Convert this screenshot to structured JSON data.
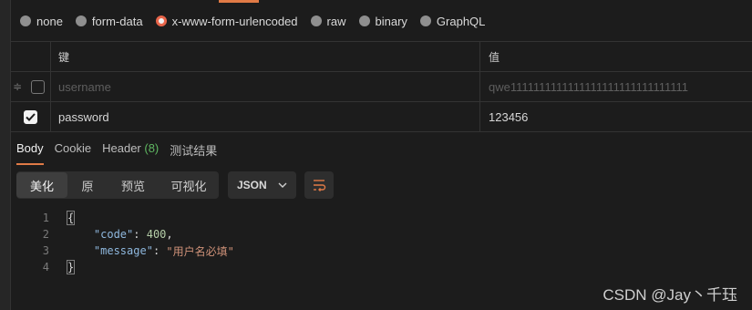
{
  "body_types": [
    {
      "label": "none",
      "selected": false
    },
    {
      "label": "form-data",
      "selected": false
    },
    {
      "label": "x-www-form-urlencoded",
      "selected": true
    },
    {
      "label": "raw",
      "selected": false
    },
    {
      "label": "binary",
      "selected": false
    },
    {
      "label": "GraphQL",
      "selected": false
    }
  ],
  "params_table": {
    "headers": {
      "key": "键",
      "value": "值"
    },
    "placeholder_row": {
      "key": "username",
      "value": "qwe1111111111111111111111111111111",
      "checked": false
    },
    "rows": [
      {
        "key": "password",
        "value": "123456",
        "checked": true
      }
    ]
  },
  "response": {
    "tabs": {
      "body": "Body",
      "cookie": "Cookie",
      "header": "Header",
      "header_count": "(8)",
      "tests": "测试结果"
    },
    "active_tab": "Body",
    "view_modes": [
      "美化",
      "原",
      "预览",
      "可视化"
    ],
    "active_view": "美化",
    "format": "JSON",
    "code": {
      "line_numbers": [
        "1",
        "2",
        "3",
        "4"
      ],
      "open_brace": "{",
      "close_brace": "}",
      "key_code": "\"code\"",
      "value_code": "400",
      "key_message": "\"message\"",
      "value_message": "\"用户名必填\""
    }
  },
  "watermark": "CSDN @Jay丶千珏",
  "colors": {
    "accent": "#e07a46",
    "radio_selected": "#e8654a",
    "count_green": "#5fb761",
    "json_key": "#8fb8de",
    "json_number": "#b5cea8",
    "json_string": "#ce9178"
  }
}
